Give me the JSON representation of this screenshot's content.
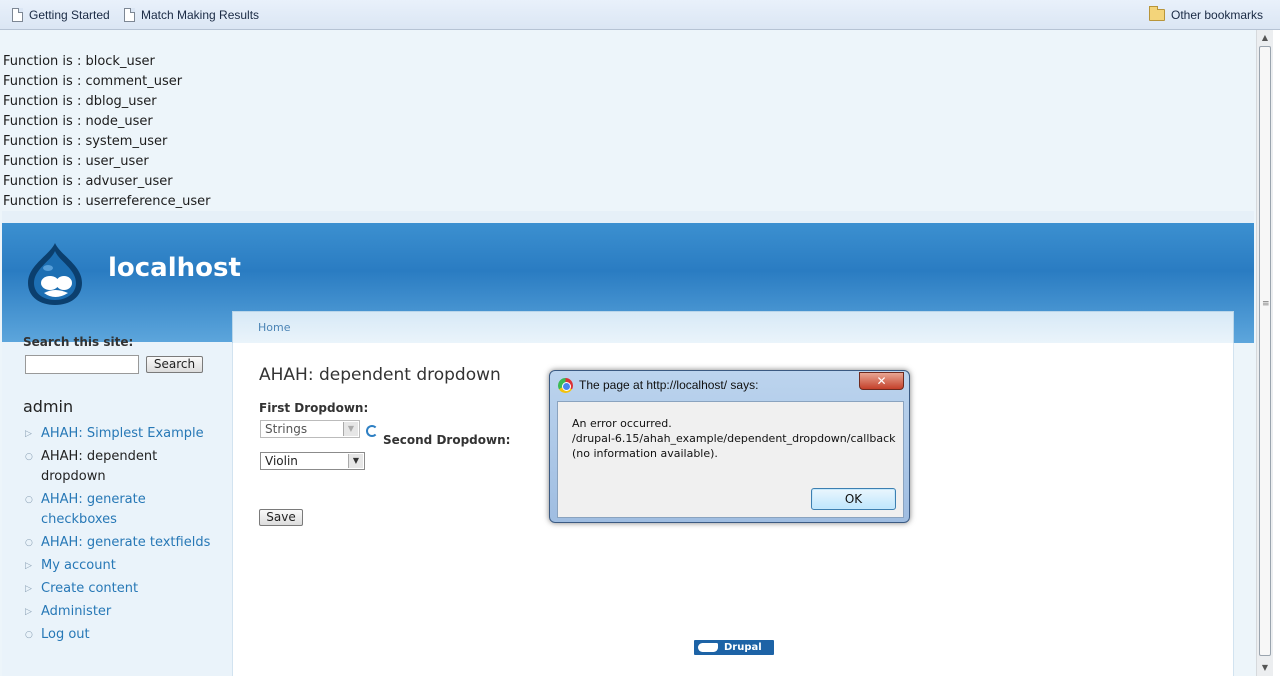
{
  "bookmarks": {
    "items": [
      {
        "label": "Getting Started"
      },
      {
        "label": "Match Making Results"
      }
    ],
    "other_label": "Other bookmarks"
  },
  "debug_lines": [
    "Function is : block_user",
    "Function is : comment_user",
    "Function is : dblog_user",
    "Function is : node_user",
    "Function is : system_user",
    "Function is : user_user",
    "Function is : advuser_user",
    "Function is : userreference_user"
  ],
  "site": {
    "name": "localhost"
  },
  "breadcrumb": {
    "home": "Home"
  },
  "sidebar": {
    "search_label": "Search this site:",
    "search_button": "Search",
    "user_title": "admin",
    "nav": [
      {
        "label": "AHAH: Simplest Example"
      },
      {
        "label": "AHAH: dependent dropdown"
      },
      {
        "label": "AHAH: generate checkboxes"
      },
      {
        "label": "AHAH: generate textfields"
      },
      {
        "label": "My account"
      },
      {
        "label": "Create content"
      },
      {
        "label": "Administer"
      },
      {
        "label": "Log out"
      }
    ]
  },
  "main": {
    "title": "AHAH: dependent dropdown",
    "first_label": "First Dropdown:",
    "first_value": "Strings",
    "second_label": "Second Dropdown:",
    "second_value": "Violin",
    "save_label": "Save",
    "badge_label": "Drupal"
  },
  "dialog": {
    "title": "The page at http://localhost/ says:",
    "close": "✕",
    "line1": "An error occurred.",
    "line2": "/drupal-6.15/ahah_example/dependent_dropdown/callback",
    "line3": "(no information available).",
    "ok_label": "OK"
  },
  "colors": {
    "header_blue": "#2a7cc2",
    "link": "#2778b6"
  }
}
